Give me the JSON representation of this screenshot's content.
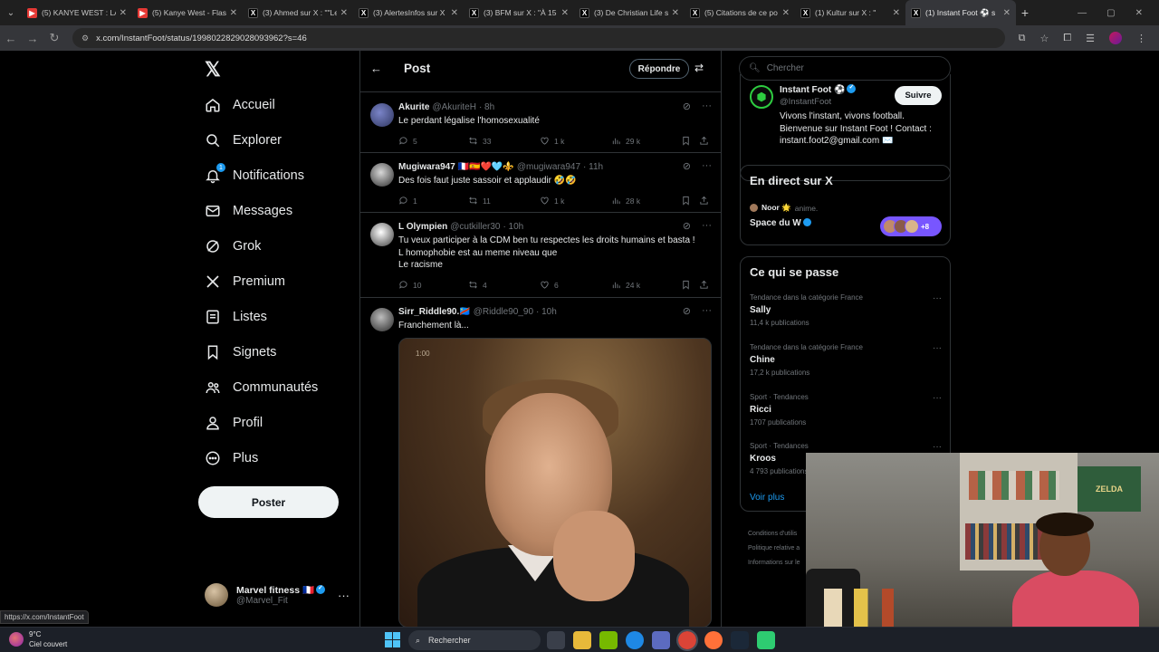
{
  "browser": {
    "tabs": [
      {
        "title": "(5) KANYE WEST : LA",
        "favicon": "youtube-favicon",
        "active": false
      },
      {
        "title": "(5) Kanye West - Flash",
        "favicon": "youtube-favicon",
        "active": false
      },
      {
        "title": "(3) Ahmed sur X : \"\"Le",
        "favicon": "x-favicon",
        "active": false
      },
      {
        "title": "(3) AlertesInfos sur X",
        "favicon": "x-favicon",
        "active": false
      },
      {
        "title": "(3) BFM sur X : \"À 15",
        "favicon": "x-favicon",
        "active": false
      },
      {
        "title": "(3) De Christian Life s",
        "favicon": "x-favicon",
        "active": false
      },
      {
        "title": "(5) Citations de ce po",
        "favicon": "x-favicon",
        "active": false
      },
      {
        "title": "(1) Kultur sur X : \"",
        "favicon": "x-favicon",
        "active": false
      },
      {
        "title": "(1) Instant Foot ⚽ s",
        "favicon": "x-favicon",
        "active": true
      }
    ],
    "url": "x.com/InstantFoot/status/1998022829028093962?s=46",
    "status_url": "https://x.com/InstantFoot"
  },
  "sidebar": {
    "items": [
      {
        "label": "Accueil",
        "icon": "home-icon"
      },
      {
        "label": "Explorer",
        "icon": "search-icon"
      },
      {
        "label": "Notifications",
        "icon": "bell-icon",
        "badge": "1"
      },
      {
        "label": "Messages",
        "icon": "mail-icon"
      },
      {
        "label": "Grok",
        "icon": "grok-icon"
      },
      {
        "label": "Premium",
        "icon": "x-logo-icon"
      },
      {
        "label": "Listes",
        "icon": "list-icon"
      },
      {
        "label": "Signets",
        "icon": "bookmark-icon"
      },
      {
        "label": "Communautés",
        "icon": "communities-icon"
      },
      {
        "label": "Profil",
        "icon": "person-icon"
      },
      {
        "label": "Plus",
        "icon": "more-circle-icon"
      }
    ],
    "post_button": "Poster",
    "account": {
      "name": "Marvel fitness 🇫🇷",
      "handle": "@Marvel_Fit"
    }
  },
  "main": {
    "title": "Post",
    "reply_button": "Répondre",
    "tweets": [
      {
        "name": "Akurite",
        "handle": "@AkuriteH",
        "time": "· 8h",
        "text": [
          "Le perdant légalise l'homosexualité"
        ],
        "replies": "5",
        "reposts": "33",
        "likes": "1 k",
        "views": "29 k"
      },
      {
        "name": "Mugiwara947 🇫🇷🇪🇸❤️🩵⚜️",
        "handle": "@mugiwara947",
        "time": "· 11h",
        "text": [
          "Des fois faut juste sassoir et applaudir 🤣🤣"
        ],
        "replies": "1",
        "reposts": "11",
        "likes": "1 k",
        "views": "28 k"
      },
      {
        "name": "L Olympien",
        "handle": "@cutkiller30",
        "time": "· 10h",
        "text": [
          "Tu veux participer à la CDM ben tu respectes les droits humains et basta !",
          "L homophobie est au meme niveau que",
          "Le racisme"
        ],
        "replies": "10",
        "reposts": "4",
        "likes": "6",
        "views": "24 k"
      },
      {
        "name": "Sirr_Riddle90.🇨🇩",
        "handle": "@Riddle90_90",
        "time": "· 10h",
        "text": [
          "Franchement là..."
        ],
        "media_timestamp": "1:00"
      }
    ]
  },
  "right": {
    "search_placeholder": "Chercher",
    "profile": {
      "name": "Instant Foot ⚽",
      "handle": "@InstantFoot",
      "follow": "Suivre",
      "bio": [
        "Vivons l'instant, vivons football.",
        "Bienvenue sur Instant Foot ! Contact :",
        "instant.foot2@gmail.com ✉️"
      ]
    },
    "live": {
      "title": "En direct sur X",
      "host": "Noor 🌟",
      "host_status": "anime.",
      "space": "Space du W",
      "extra_count": "+8"
    },
    "trends": {
      "title": "Ce qui se passe",
      "items": [
        {
          "category": "Tendance dans la catégorie France",
          "name": "Sally",
          "count": "11,4 k publications"
        },
        {
          "category": "Tendance dans la catégorie France",
          "name": "Chine",
          "count": "17,2 k publications"
        },
        {
          "category": "Sport · Tendances",
          "name": "Ricci",
          "count": "1707 publications"
        },
        {
          "category": "Sport · Tendances",
          "name": "Kroos",
          "count": "4 793 publications"
        }
      ],
      "show_more": "Voir plus"
    },
    "footer": [
      "Conditions d'utilis",
      "Politique relative a",
      "Informations sur le"
    ]
  },
  "webcam": {
    "poster_text": "ZELDA"
  },
  "taskbar": {
    "temperature": "9°C",
    "weather": "Ciel couvert",
    "search_label": "Rechercher"
  }
}
